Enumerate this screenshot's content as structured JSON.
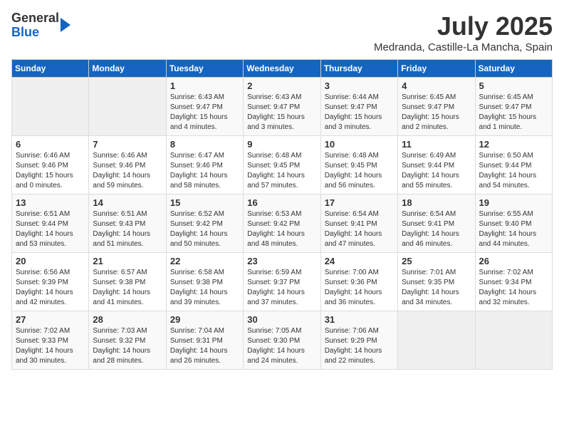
{
  "header": {
    "logo_line1": "General",
    "logo_line2": "Blue",
    "month": "July 2025",
    "location": "Medranda, Castille-La Mancha, Spain"
  },
  "weekdays": [
    "Sunday",
    "Monday",
    "Tuesday",
    "Wednesday",
    "Thursday",
    "Friday",
    "Saturday"
  ],
  "weeks": [
    [
      {
        "day": "",
        "info": ""
      },
      {
        "day": "",
        "info": ""
      },
      {
        "day": "1",
        "info": "Sunrise: 6:43 AM\nSunset: 9:47 PM\nDaylight: 15 hours and 4 minutes."
      },
      {
        "day": "2",
        "info": "Sunrise: 6:43 AM\nSunset: 9:47 PM\nDaylight: 15 hours and 3 minutes."
      },
      {
        "day": "3",
        "info": "Sunrise: 6:44 AM\nSunset: 9:47 PM\nDaylight: 15 hours and 3 minutes."
      },
      {
        "day": "4",
        "info": "Sunrise: 6:45 AM\nSunset: 9:47 PM\nDaylight: 15 hours and 2 minutes."
      },
      {
        "day": "5",
        "info": "Sunrise: 6:45 AM\nSunset: 9:47 PM\nDaylight: 15 hours and 1 minute."
      }
    ],
    [
      {
        "day": "6",
        "info": "Sunrise: 6:46 AM\nSunset: 9:46 PM\nDaylight: 15 hours and 0 minutes."
      },
      {
        "day": "7",
        "info": "Sunrise: 6:46 AM\nSunset: 9:46 PM\nDaylight: 14 hours and 59 minutes."
      },
      {
        "day": "8",
        "info": "Sunrise: 6:47 AM\nSunset: 9:46 PM\nDaylight: 14 hours and 58 minutes."
      },
      {
        "day": "9",
        "info": "Sunrise: 6:48 AM\nSunset: 9:45 PM\nDaylight: 14 hours and 57 minutes."
      },
      {
        "day": "10",
        "info": "Sunrise: 6:48 AM\nSunset: 9:45 PM\nDaylight: 14 hours and 56 minutes."
      },
      {
        "day": "11",
        "info": "Sunrise: 6:49 AM\nSunset: 9:44 PM\nDaylight: 14 hours and 55 minutes."
      },
      {
        "day": "12",
        "info": "Sunrise: 6:50 AM\nSunset: 9:44 PM\nDaylight: 14 hours and 54 minutes."
      }
    ],
    [
      {
        "day": "13",
        "info": "Sunrise: 6:51 AM\nSunset: 9:44 PM\nDaylight: 14 hours and 53 minutes."
      },
      {
        "day": "14",
        "info": "Sunrise: 6:51 AM\nSunset: 9:43 PM\nDaylight: 14 hours and 51 minutes."
      },
      {
        "day": "15",
        "info": "Sunrise: 6:52 AM\nSunset: 9:42 PM\nDaylight: 14 hours and 50 minutes."
      },
      {
        "day": "16",
        "info": "Sunrise: 6:53 AM\nSunset: 9:42 PM\nDaylight: 14 hours and 48 minutes."
      },
      {
        "day": "17",
        "info": "Sunrise: 6:54 AM\nSunset: 9:41 PM\nDaylight: 14 hours and 47 minutes."
      },
      {
        "day": "18",
        "info": "Sunrise: 6:54 AM\nSunset: 9:41 PM\nDaylight: 14 hours and 46 minutes."
      },
      {
        "day": "19",
        "info": "Sunrise: 6:55 AM\nSunset: 9:40 PM\nDaylight: 14 hours and 44 minutes."
      }
    ],
    [
      {
        "day": "20",
        "info": "Sunrise: 6:56 AM\nSunset: 9:39 PM\nDaylight: 14 hours and 42 minutes."
      },
      {
        "day": "21",
        "info": "Sunrise: 6:57 AM\nSunset: 9:38 PM\nDaylight: 14 hours and 41 minutes."
      },
      {
        "day": "22",
        "info": "Sunrise: 6:58 AM\nSunset: 9:38 PM\nDaylight: 14 hours and 39 minutes."
      },
      {
        "day": "23",
        "info": "Sunrise: 6:59 AM\nSunset: 9:37 PM\nDaylight: 14 hours and 37 minutes."
      },
      {
        "day": "24",
        "info": "Sunrise: 7:00 AM\nSunset: 9:36 PM\nDaylight: 14 hours and 36 minutes."
      },
      {
        "day": "25",
        "info": "Sunrise: 7:01 AM\nSunset: 9:35 PM\nDaylight: 14 hours and 34 minutes."
      },
      {
        "day": "26",
        "info": "Sunrise: 7:02 AM\nSunset: 9:34 PM\nDaylight: 14 hours and 32 minutes."
      }
    ],
    [
      {
        "day": "27",
        "info": "Sunrise: 7:02 AM\nSunset: 9:33 PM\nDaylight: 14 hours and 30 minutes."
      },
      {
        "day": "28",
        "info": "Sunrise: 7:03 AM\nSunset: 9:32 PM\nDaylight: 14 hours and 28 minutes."
      },
      {
        "day": "29",
        "info": "Sunrise: 7:04 AM\nSunset: 9:31 PM\nDaylight: 14 hours and 26 minutes."
      },
      {
        "day": "30",
        "info": "Sunrise: 7:05 AM\nSunset: 9:30 PM\nDaylight: 14 hours and 24 minutes."
      },
      {
        "day": "31",
        "info": "Sunrise: 7:06 AM\nSunset: 9:29 PM\nDaylight: 14 hours and 22 minutes."
      },
      {
        "day": "",
        "info": ""
      },
      {
        "day": "",
        "info": ""
      }
    ]
  ]
}
